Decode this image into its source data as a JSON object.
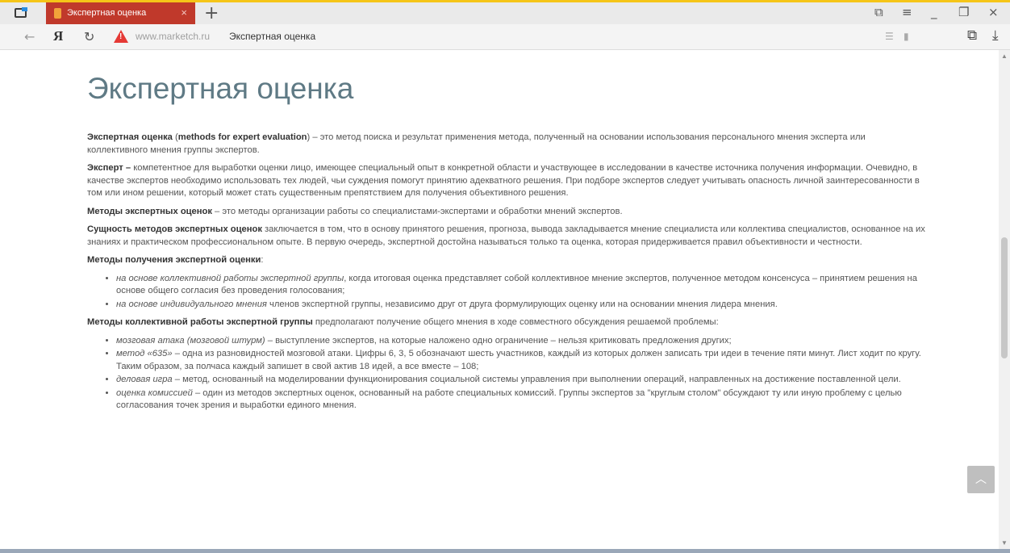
{
  "tab": {
    "title": "Экспертная оценка",
    "close": "×"
  },
  "toolbar": {
    "new_tab": "+"
  },
  "address": {
    "domain": "www.marketch.ru",
    "page_title": "Экспертная оценка"
  },
  "page": {
    "heading": "Экспертная оценка",
    "p1": {
      "term": "Экспертная оценка",
      "en_open": " (",
      "en": "methods for expert evaluation",
      "rest": ") – это метод поиска и результат применения метода, полученный на основании использования персонального мнения эксперта или коллективного мнения группы экспертов."
    },
    "p2": {
      "term": "Эксперт –",
      "rest": " компетентное для выработки оценки лицо, имеющее специальный опыт в конкретной области и участвующее в исследовании в качестве источника получения информации. Очевидно, в качестве экспертов необходимо использовать тех людей, чьи суждения помогут принятию адекватного решения. При подборе экспертов следует учитывать опасность личной заинтересованности в том или ином решении, который может стать существенным препятствием для получения объективного решения."
    },
    "p3": {
      "term": "Методы экспертных оценок",
      "rest": " – это методы организации работы со специалистами-экспертами и обработки мнений экспертов."
    },
    "p4": {
      "term": "Сущность методов экспертных оценок",
      "rest": " заключается в том, что в основу принятого решения, прогноза, вывода закладывается мнение специалиста или коллектива специалистов, основанное на их знаниях и практическом профессиональном опыте. В первую очередь, экспертной достойна называться только та оценка, которая придерживается правил объективности и честности."
    },
    "p5": {
      "term": "Методы получения экспертной оценки",
      "rest": ":"
    },
    "list1": [
      {
        "em": "на основе коллективной работы экспертной группы",
        "rest": ", когда итоговая оценка представляет собой коллективное мнение экспертов, полученное методом консенсуса – принятием решения на основе общего согласия без проведения голосования;"
      },
      {
        "em": "на основе индивидуального мнения",
        "rest": " членов экспертной группы, независимо друг от друга формулирующих оценку или на основании мнения лидера мнения."
      }
    ],
    "p6": {
      "term": "Методы коллективной работы экспертной группы",
      "rest": " предполагают получение общего мнения в ходе совместного обсуждения решаемой проблемы:"
    },
    "list2": [
      {
        "em": "мозговая атака (мозговой штурм)",
        "rest": " – выступление экспертов, на которые наложено одно ограничение – нельзя критиковать предложения других;"
      },
      {
        "em": "метод «635»",
        "rest": " – одна из разновидностей мозговой атаки. Цифры 6, 3, 5 обозначают шесть участников, каждый из которых должен записать три идеи в течение пяти минут. Лист ходит по кругу. Таким образом, за полчаса каждый запишет в свой актив 18 идей, а все вместе – 108;"
      },
      {
        "em": "деловая игра",
        "rest": " – метод, основанный на моделировании функционирования социальной системы управления при выполнении операций, направленных на достижение поставленной цели."
      },
      {
        "em": "оценка комиссией",
        "rest": " – один из методов экспертных оценок, основанный на работе специальных комиссий. Группы экспертов за \"круглым столом\" обсуждают ту или иную проблему с целью согласования точек зрения и выработки единого мнения."
      }
    ]
  },
  "colors": {
    "accent": "#f5c518",
    "tab": "#c0392b",
    "heading": "#5f7a85",
    "warning": "#e53935"
  },
  "icons": [
    "tabs-icon",
    "favicon-icon",
    "back-icon",
    "yandex-logo-icon",
    "refresh-icon",
    "warning-icon",
    "reader-icon",
    "bookmark-icon",
    "tablet-icon",
    "menu-icon",
    "minimize-icon",
    "restore-icon",
    "close-icon",
    "translate-icon",
    "download-icon",
    "scroll-top-icon"
  ]
}
